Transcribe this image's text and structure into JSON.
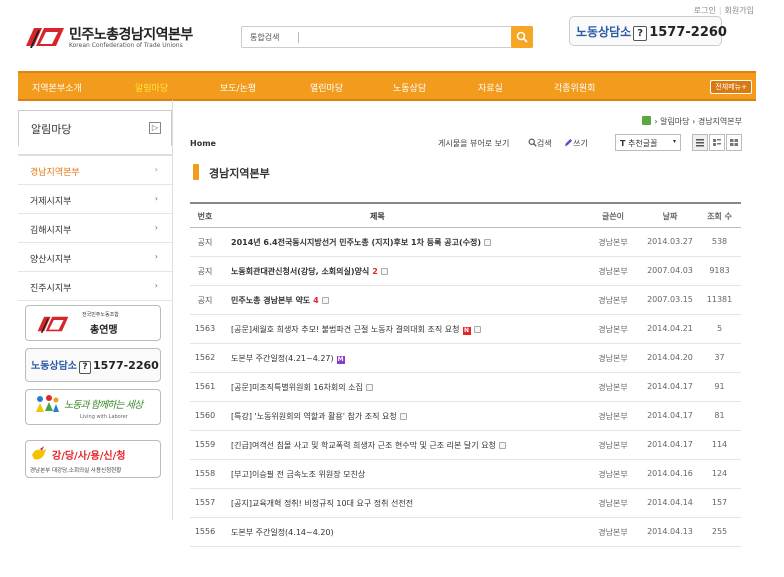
{
  "top_links": {
    "login": "로그인",
    "join": "회원가입"
  },
  "logo": {
    "title": "민주노총경남지역본부",
    "subtitle": "Korean Confederation of Trade Unions"
  },
  "search": {
    "placeholder": "통합검색"
  },
  "hotline": {
    "label": "노동상담소",
    "question": "?",
    "number": "1577-2260"
  },
  "nav": {
    "items": [
      "지역본부소개",
      "알림마당",
      "보도/논평",
      "열린마당",
      "노동상담",
      "자료실",
      "각종위원회"
    ],
    "all_menu": "전체메뉴+"
  },
  "sidebar": {
    "title": "알림마당",
    "toggle": "▷",
    "items": [
      {
        "label": "경남지역본부",
        "arrow": "›"
      },
      {
        "label": "거제시지부",
        "arrow": "›"
      },
      {
        "label": "김해시지부",
        "arrow": "›"
      },
      {
        "label": "양산시지부",
        "arrow": "›"
      },
      {
        "label": "진주시지부",
        "arrow": "›"
      }
    ],
    "banners": {
      "union_small": "전국민주노동조합",
      "union_main": "총연맹",
      "hotline_label": "노동상담소",
      "hotline_number": "1577-2260",
      "calligraphy": "노동과 함께하는 세상",
      "calligraphy_sub": "Living with Laborer",
      "hall_main": "강/당/사/용/신/청",
      "hall_sub": "경남본부 대강당,소회의실 사용신청현황"
    }
  },
  "breadcrumb": {
    "sep": "›",
    "level1": "알림마당",
    "level2": "경남지역본부"
  },
  "home_label": "Home",
  "tools": {
    "view_all": "게시물을 뷰어로 보기",
    "search": "검색",
    "write": "쓰기"
  },
  "sort": {
    "selected": "추천글꼴",
    "icon": "T"
  },
  "section_title": "경남지역본부",
  "table": {
    "headers": {
      "no": "번호",
      "title": "제목",
      "writer": "글쓴이",
      "date": "날짜",
      "views": "조회 수"
    },
    "rows": [
      {
        "no": "공지",
        "title": "2014년 6.4전국동시지방선거 민주노총 (지지)후보 1차 등록 공고(수정)",
        "comments": "",
        "badge": "doc",
        "writer": "경남본부",
        "date": "2014.03.27",
        "views": "538",
        "notice": true
      },
      {
        "no": "공지",
        "title": "노동회관대관신청서(강당, 소회의실)양식",
        "comments": "2",
        "badge": "doc",
        "writer": "경남본부",
        "date": "2007.04.03",
        "views": "9183",
        "notice": true
      },
      {
        "no": "공지",
        "title": "민주노총 경남본부 약도",
        "comments": "4",
        "badge": "doc",
        "writer": "경남본부",
        "date": "2007.03.15",
        "views": "11381",
        "notice": true
      },
      {
        "no": "1563",
        "title": "[공문]세월호 희생자 추모! 불법파견 근절 노동자 결의대회 조직 요청",
        "comments": "",
        "badge": "new",
        "writer": "경남본부",
        "date": "2014.04.21",
        "views": "5",
        "notice": false
      },
      {
        "no": "1562",
        "title": "도본부 주간일정(4.21~4.27)",
        "comments": "",
        "badge": "m",
        "writer": "경남본부",
        "date": "2014.04.20",
        "views": "37",
        "notice": false
      },
      {
        "no": "1561",
        "title": "[공문]미조직특별위원회 16차회의 소집",
        "comments": "",
        "badge": "doc",
        "writer": "경남본부",
        "date": "2014.04.17",
        "views": "91",
        "notice": false
      },
      {
        "no": "1560",
        "title": "[특강] '노동위원회의 역할과 활용' 참가 조직 요청",
        "comments": "",
        "badge": "doc",
        "writer": "경남본부",
        "date": "2014.04.17",
        "views": "81",
        "notice": false
      },
      {
        "no": "1559",
        "title": "[긴급]여객선 침몰 사고 및 학교폭력 희생자 근조 현수막 및 근조 리본 달기 요청",
        "comments": "",
        "badge": "doc",
        "writer": "경남본부",
        "date": "2014.04.17",
        "views": "114",
        "notice": false
      },
      {
        "no": "1558",
        "title": "[부고]이승필 전 금속노조 위원장 모친상",
        "comments": "",
        "badge": "",
        "writer": "경남본부",
        "date": "2014.04.16",
        "views": "124",
        "notice": false
      },
      {
        "no": "1557",
        "title": "[공지]교육개혁 정취! 비정규직 10대 요구 정취 선전전",
        "comments": "",
        "badge": "",
        "writer": "경남본부",
        "date": "2014.04.14",
        "views": "157",
        "notice": false
      },
      {
        "no": "1556",
        "title": "도본부 주간일정(4.14~4.20)",
        "comments": "",
        "badge": "",
        "writer": "경남본부",
        "date": "2014.04.13",
        "views": "255",
        "notice": false
      }
    ]
  },
  "colors": {
    "accent": "#f29b1c",
    "active": "#e57a14",
    "hotline_blue": "#2a5aa8",
    "new_badge": "#e5242a"
  }
}
